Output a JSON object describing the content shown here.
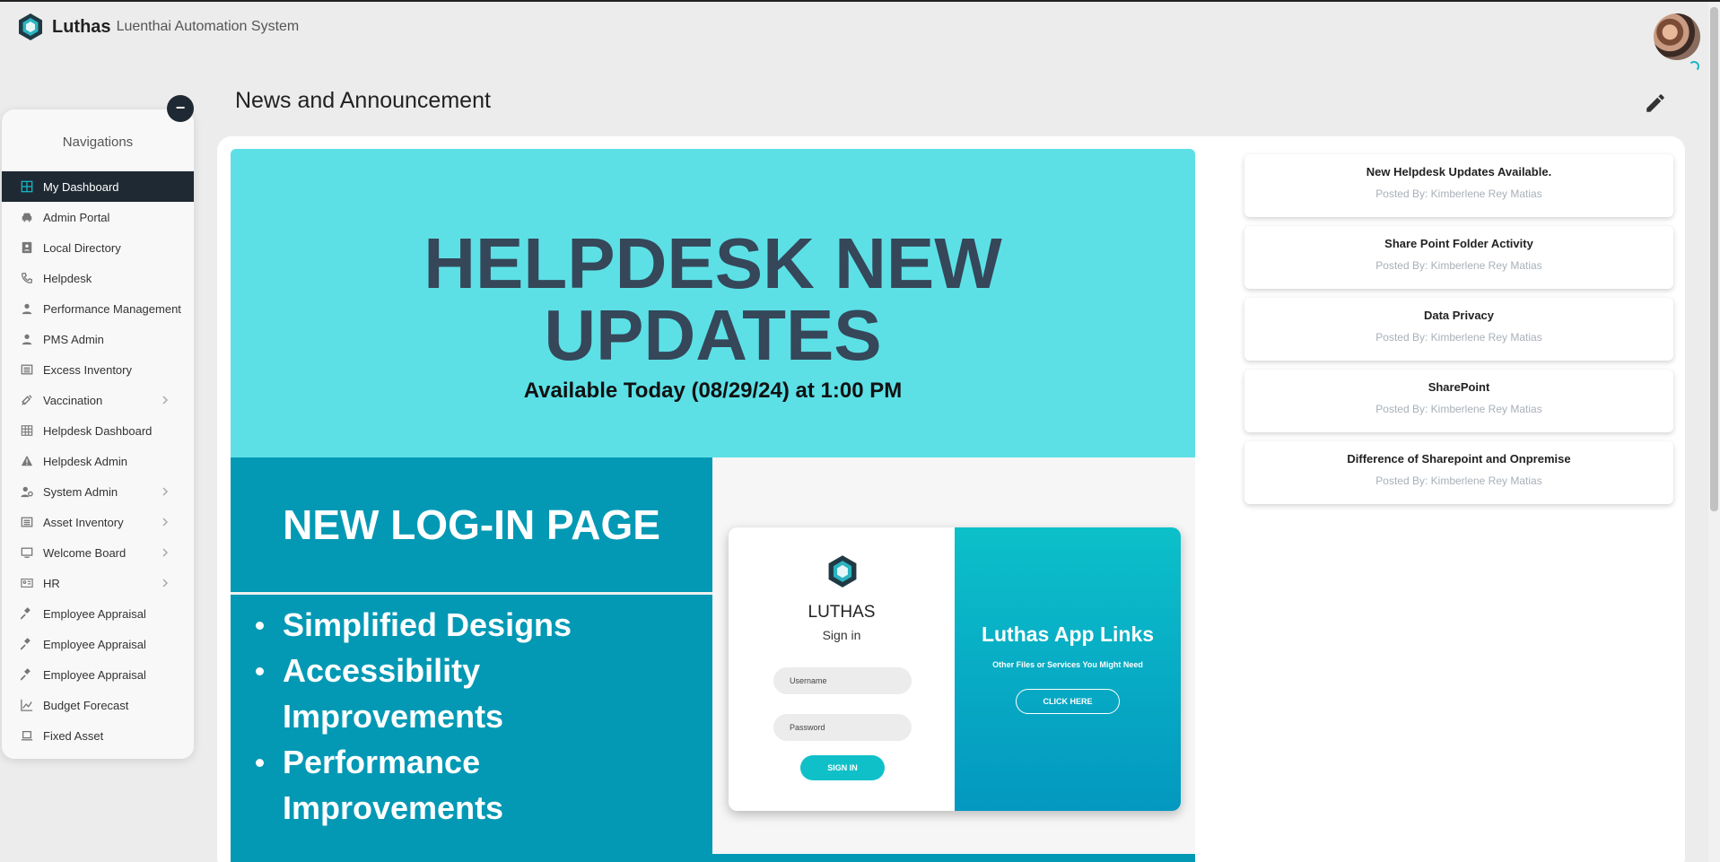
{
  "header": {
    "brand_name": "Luthas",
    "brand_subtitle": "Luenthai Automation System"
  },
  "sidebar": {
    "title": "Navigations",
    "collapse_label": "−",
    "items": [
      {
        "label": "My Dashboard",
        "icon": "dashboard-icon",
        "active": true,
        "has_children": false
      },
      {
        "label": "Admin Portal",
        "icon": "car-icon",
        "has_children": false
      },
      {
        "label": "Local Directory",
        "icon": "contact-book-icon",
        "has_children": false
      },
      {
        "label": "Helpdesk",
        "icon": "phone-icon",
        "has_children": false
      },
      {
        "label": "Performance Management",
        "icon": "user-icon",
        "has_children": false
      },
      {
        "label": "PMS Admin",
        "icon": "user-icon",
        "has_children": false
      },
      {
        "label": "Excess Inventory",
        "icon": "list-icon",
        "has_children": false
      },
      {
        "label": "Vaccination",
        "icon": "syringe-icon",
        "has_children": true
      },
      {
        "label": "Helpdesk Dashboard",
        "icon": "table-icon",
        "has_children": false
      },
      {
        "label": "Helpdesk Admin",
        "icon": "warning-icon",
        "has_children": false
      },
      {
        "label": "System Admin",
        "icon": "user-cog-icon",
        "has_children": true
      },
      {
        "label": "Asset Inventory",
        "icon": "list-icon",
        "has_children": true
      },
      {
        "label": "Welcome Board",
        "icon": "monitor-icon",
        "has_children": true
      },
      {
        "label": "HR",
        "icon": "id-card-icon",
        "has_children": true
      },
      {
        "label": "Employee Appraisal",
        "icon": "gavel-icon",
        "has_children": false
      },
      {
        "label": "Employee Appraisal",
        "icon": "gavel-icon",
        "has_children": false
      },
      {
        "label": "Employee Appraisal",
        "icon": "gavel-icon",
        "has_children": false
      },
      {
        "label": "Budget Forecast",
        "icon": "line-chart-icon",
        "has_children": false
      },
      {
        "label": "Fixed Asset",
        "icon": "laptop-icon",
        "has_children": false
      }
    ]
  },
  "main": {
    "title": "News and Announcement"
  },
  "banner": {
    "headline_line1": "HELPDESK NEW",
    "headline_line2": "UPDATES",
    "subheadline": "Available Today (08/29/24) at 1:00 PM",
    "login_title": "NEW LOG-IN PAGE",
    "bullets": [
      "Simplified Designs",
      "Accessibility Improvements",
      "Performance Improvements"
    ],
    "mock": {
      "brand": "LUTHAS",
      "signin": "Sign in",
      "username_placeholder": "Username",
      "password_placeholder": "Password",
      "signin_button": "SIGN IN",
      "right_title": "Luthas App Links",
      "right_subtitle": "Other Files or Services You Might Need",
      "right_button": "CLICK HERE"
    }
  },
  "announcements": [
    {
      "title": "New Helpdesk Updates Available.",
      "posted_by": "Posted By: Kimberlene Rey Matias"
    },
    {
      "title": "Share Point Folder Activity",
      "posted_by": "Posted By: Kimberlene Rey Matias"
    },
    {
      "title": "Data Privacy",
      "posted_by": "Posted By: Kimberlene Rey Matias"
    },
    {
      "title": "SharePoint",
      "posted_by": "Posted By: Kimberlene Rey Matias"
    },
    {
      "title": "Difference of Sharepoint and Onpremise",
      "posted_by": "Posted By: Kimberlene Rey Matias"
    }
  ],
  "colors": {
    "accent": "#18b6c4",
    "nav_active_bg": "#1f2933",
    "banner_cyan": "#5ce0e6",
    "banner_teal": "#0399b5",
    "headline": "#354759"
  }
}
